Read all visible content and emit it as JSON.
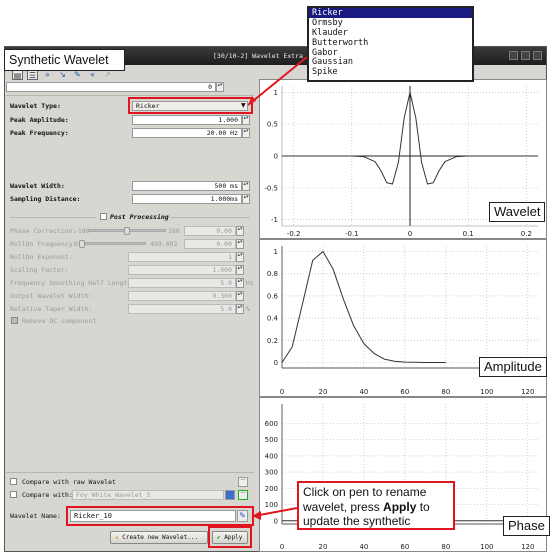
{
  "window": {
    "title": "[30/10-2] Wavelet Extra"
  },
  "callout_title": "Synthetic Wavelet",
  "toolbar": {
    "icons": [
      "save-icon",
      "list-icon",
      "forward-icon",
      "back-icon",
      "pen-icon",
      "rewind-icon",
      "arrow-icon"
    ]
  },
  "top_field": {
    "value": "0"
  },
  "params": {
    "wavelet_type_label": "Wavelet Type:",
    "wavelet_type_value": "Ricker",
    "peak_amplitude_label": "Peak Amplitude:",
    "peak_amplitude_value": "1.000",
    "peak_frequency_label": "Peak Frequency:",
    "peak_frequency_value": "20.00 Hz",
    "wavelet_width_label": "Wavelet Width:",
    "wavelet_width_value": "500 ms",
    "sampling_distance_label": "Sampling Distance:",
    "sampling_distance_value": "1.000ms"
  },
  "post": {
    "title": "Post Processing",
    "phase_correction_label": "Phase Correction:",
    "phase_min": "-180",
    "phase_max": "180",
    "phase_value": "0.00",
    "rolloff_freq_label": "RollOn Frequency:",
    "rolloff_min": "0",
    "rolloff_max": "499.002",
    "rolloff_value": "0.00",
    "rolloff_exp_label": "RollOn Exponent:",
    "rolloff_exp_value": "1",
    "scaling_label": "Scaling Factor:",
    "scaling_value": "1.000",
    "smoothing_label": "Frequency Smoothing Half Length:",
    "smoothing_value": "5.0",
    "smoothing_unit": "Hz",
    "output_width_label": "Output Wavelet Width:",
    "output_width_value": "0.300",
    "taper_label": "Relative Taper Width:",
    "taper_value": "5.0",
    "taper_unit": "%",
    "remove_dc_label": "Remove DC component"
  },
  "compare": {
    "raw_label": "Compare with raw Wavelet",
    "with_label": "Compare with:",
    "with_value": "Foy_White_Wavelet_5"
  },
  "name": {
    "label": "Wavelet Name:",
    "value": "Ricker_10"
  },
  "buttons": {
    "create": "Create new Wavelet...",
    "apply": "Apply"
  },
  "dropdown": {
    "options": [
      "Ricker",
      "Ormsby",
      "Klauder",
      "Butterworth",
      "Gabor",
      "Gaussian",
      "Spike"
    ],
    "selected": "Ricker"
  },
  "annotation": {
    "text1": "Click on pen to rename wavelet, press ",
    "bold": "Apply",
    "text2": " to update the synthetic"
  },
  "plot_labels": {
    "wavelet": "Wavelet",
    "amplitude": "Amplitude",
    "phase": "Phase"
  },
  "chart_data": [
    {
      "type": "line",
      "name": "Wavelet",
      "x_ticks": [
        "-0.2",
        "-0.1",
        "0",
        "0.1",
        "0.2"
      ],
      "y_ticks": [
        "-1",
        "-0.5",
        "0",
        "0.5",
        "1"
      ],
      "xlim": [
        -0.22,
        0.22
      ],
      "ylim": [
        -1.1,
        1.1
      ],
      "grid": true,
      "x": [
        -0.1,
        -0.08,
        -0.06,
        -0.05,
        -0.04,
        -0.03,
        -0.02,
        -0.01,
        0,
        0.01,
        0.02,
        0.03,
        0.04,
        0.05,
        0.06,
        0.08,
        0.1
      ],
      "y": [
        0,
        -0.01,
        -0.09,
        -0.23,
        -0.42,
        -0.44,
        -0.1,
        0.6,
        1.0,
        0.6,
        -0.1,
        -0.44,
        -0.42,
        -0.23,
        -0.09,
        -0.01,
        0
      ]
    },
    {
      "type": "line",
      "name": "Amplitude",
      "x_ticks": [
        "0",
        "20",
        "40",
        "60",
        "80",
        "100",
        "120"
      ],
      "y_ticks": [
        "0",
        "0.2",
        "0.4",
        "0.6",
        "0.8",
        "1"
      ],
      "xlim": [
        0,
        125
      ],
      "ylim": [
        -0.05,
        1.05
      ],
      "grid": true,
      "x": [
        0,
        5,
        10,
        15,
        20,
        25,
        30,
        35,
        40,
        45,
        50,
        55,
        60,
        65,
        70,
        75,
        80
      ],
      "y": [
        0,
        0.14,
        0.53,
        0.92,
        1.0,
        0.84,
        0.57,
        0.33,
        0.17,
        0.08,
        0.03,
        0.01,
        0.003,
        0.001,
        0,
        0,
        0
      ]
    },
    {
      "type": "line",
      "name": "Phase",
      "x_ticks": [
        "0",
        "20",
        "40",
        "60",
        "80",
        "100",
        "120"
      ],
      "y_ticks": [
        "0",
        "100",
        "200",
        "300",
        "400",
        "500",
        "600"
      ],
      "xlim": [
        0,
        125
      ],
      "ylim": [
        -20,
        720
      ],
      "grid": true,
      "x": [
        0,
        125
      ],
      "y": [
        0,
        0
      ]
    }
  ]
}
